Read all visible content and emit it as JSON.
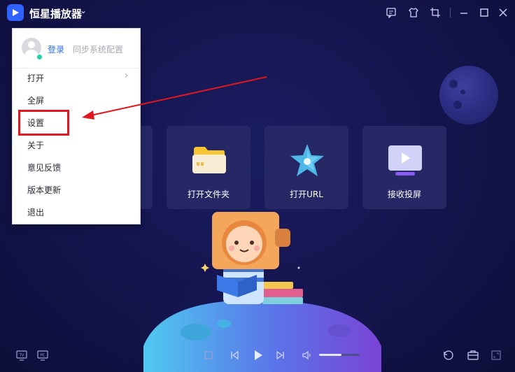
{
  "app": {
    "title": "恒星播放器",
    "accent": "#2f62ff",
    "background": "#12134a"
  },
  "titlebar": {
    "icons": [
      "feedback-icon",
      "skin-icon",
      "crop-icon",
      "minimize-icon",
      "maximize-icon",
      "close-icon"
    ]
  },
  "cards": [
    {
      "label": "打开文件夹",
      "icon": "folder-icon"
    },
    {
      "label": "打开URL",
      "icon": "star-url-icon"
    },
    {
      "label": "接收投屏",
      "icon": "cast-icon"
    }
  ],
  "menu": {
    "login_label": "登录",
    "sync_label": "同步系统配置",
    "items": [
      {
        "label": "打开",
        "has_submenu": true
      },
      {
        "label": "全屏"
      },
      {
        "label": "设置",
        "highlighted": true
      },
      {
        "label": "关于"
      },
      {
        "label": "意见反馈"
      },
      {
        "label": "版本更新"
      },
      {
        "label": "退出"
      }
    ],
    "highlight_color": "#e0171e"
  },
  "bottombar": {
    "icons": [
      "tv-icon",
      "pc-icon",
      "stop-icon",
      "prev-icon",
      "play-icon",
      "next-icon",
      "volume-icon",
      "rotate-icon",
      "toolbox-icon",
      "fullscreen-icon"
    ],
    "volume_percent": 55
  }
}
